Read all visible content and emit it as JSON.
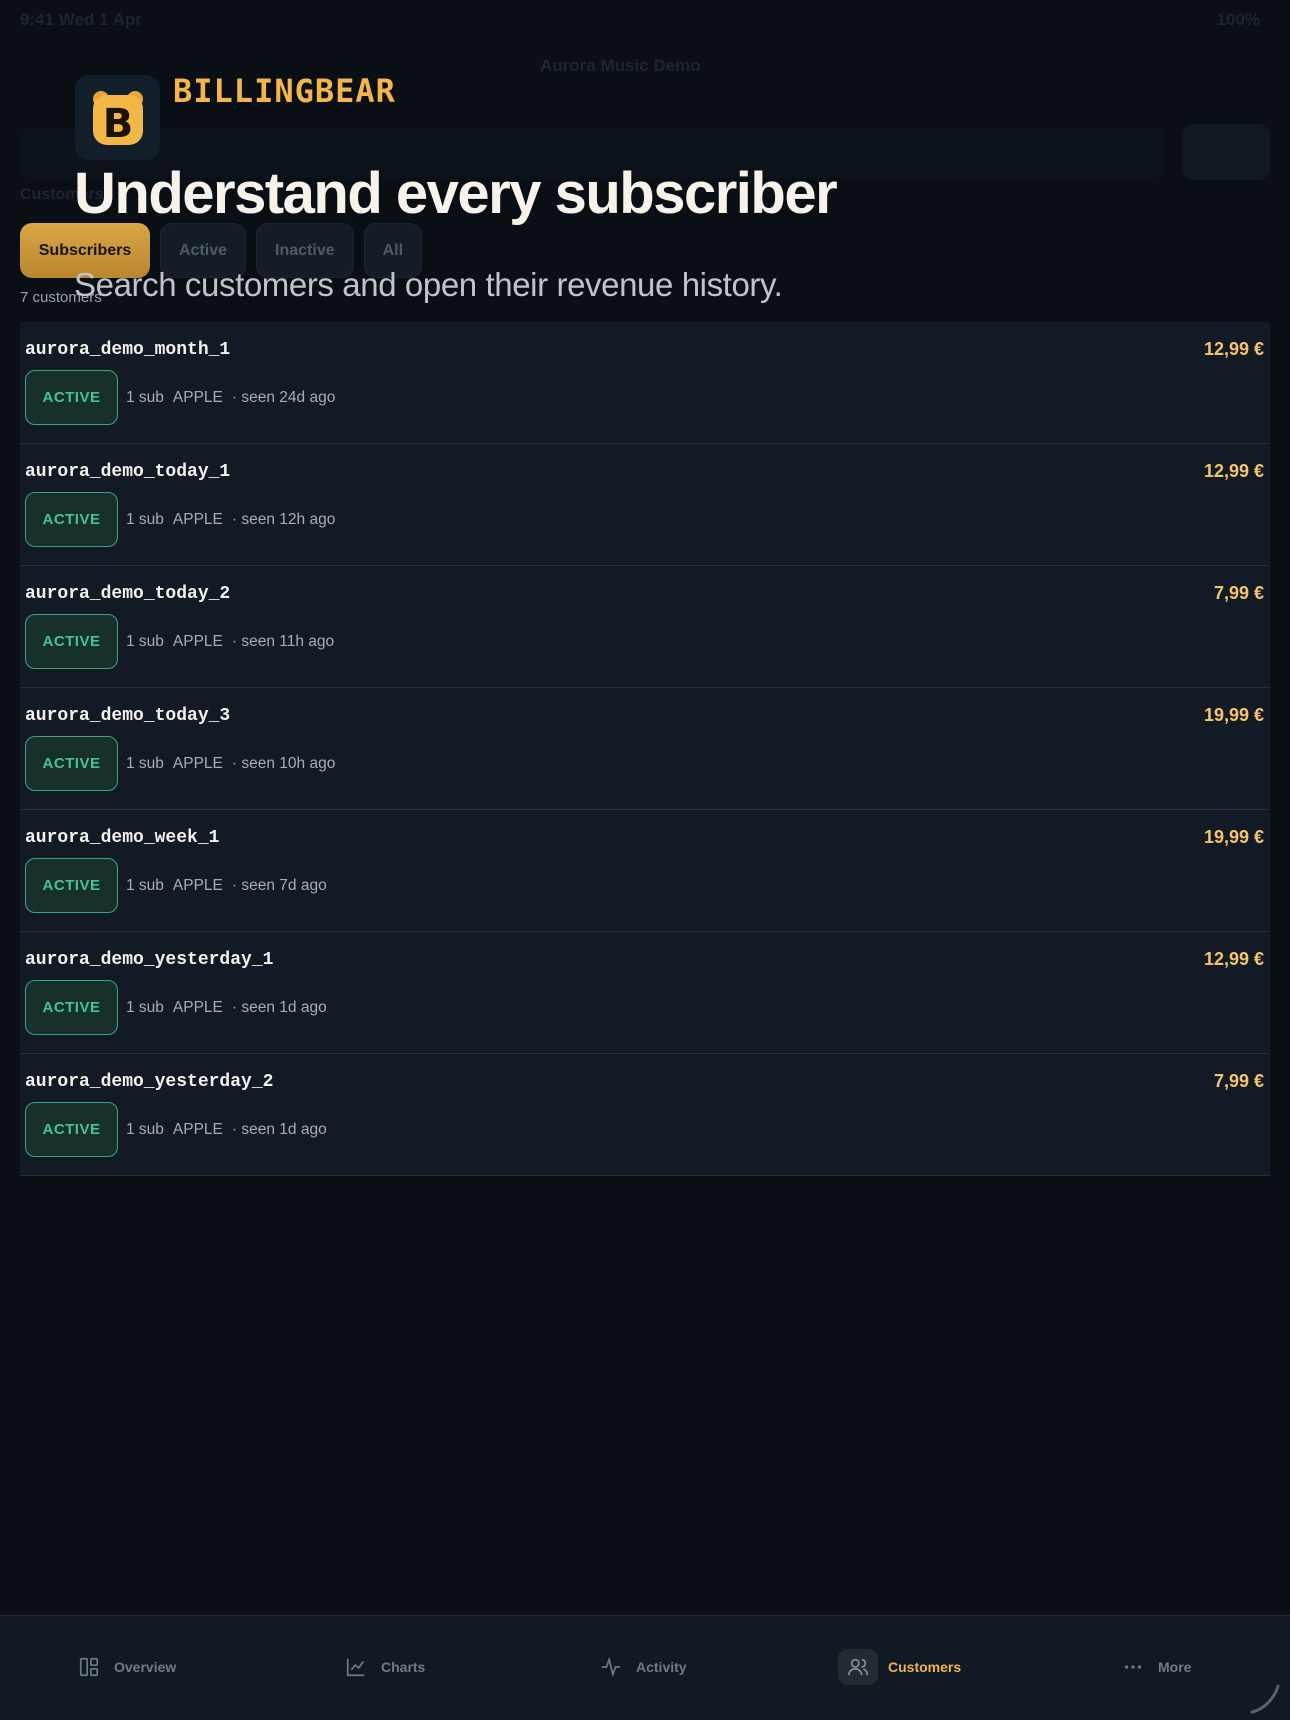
{
  "ghost": {
    "status_left": "9:41  Wed 1 Apr",
    "status_right": "100%",
    "app_title": "Aurora Music Demo",
    "section": "Customers"
  },
  "promo": {
    "brand": "BILLINGBEAR",
    "logo_letter": "B",
    "headline": "Understand every subscriber",
    "subhead": "Search customers and open their revenue history."
  },
  "filters": [
    {
      "label": "Subscribers",
      "selected": true
    },
    {
      "label": "Active",
      "selected": false
    },
    {
      "label": "Inactive",
      "selected": false
    },
    {
      "label": "All",
      "selected": false
    }
  ],
  "count_label": "7 customers",
  "customers": [
    {
      "name": "aurora_demo_month_1",
      "status": "ACTIVE",
      "subs": "1 sub",
      "store": "APPLE",
      "seen": "· seen 24d ago",
      "amount": "12,99 €"
    },
    {
      "name": "aurora_demo_today_1",
      "status": "ACTIVE",
      "subs": "1 sub",
      "store": "APPLE",
      "seen": "· seen 12h ago",
      "amount": "12,99 €"
    },
    {
      "name": "aurora_demo_today_2",
      "status": "ACTIVE",
      "subs": "1 sub",
      "store": "APPLE",
      "seen": "· seen 11h ago",
      "amount": "7,99 €"
    },
    {
      "name": "aurora_demo_today_3",
      "status": "ACTIVE",
      "subs": "1 sub",
      "store": "APPLE",
      "seen": "· seen 10h ago",
      "amount": "19,99 €"
    },
    {
      "name": "aurora_demo_week_1",
      "status": "ACTIVE",
      "subs": "1 sub",
      "store": "APPLE",
      "seen": "· seen 7d ago",
      "amount": "19,99 €"
    },
    {
      "name": "aurora_demo_yesterday_1",
      "status": "ACTIVE",
      "subs": "1 sub",
      "store": "APPLE",
      "seen": "· seen 1d ago",
      "amount": "12,99 €"
    },
    {
      "name": "aurora_demo_yesterday_2",
      "status": "ACTIVE",
      "subs": "1 sub",
      "store": "APPLE",
      "seen": "· seen 1d ago",
      "amount": "7,99 €"
    }
  ],
  "tabs": [
    {
      "label": "Overview",
      "icon": "dashboard-icon"
    },
    {
      "label": "Charts",
      "icon": "line-chart-icon"
    },
    {
      "label": "Activity",
      "icon": "pulse-icon"
    },
    {
      "label": "Customers",
      "icon": "users-icon",
      "current": true
    },
    {
      "label": "More",
      "icon": "ellipsis-icon"
    }
  ],
  "colors": {
    "accent": "#f4b54a",
    "active_green": "#46c393",
    "background": "#0a0f16",
    "row": "#121b25"
  }
}
